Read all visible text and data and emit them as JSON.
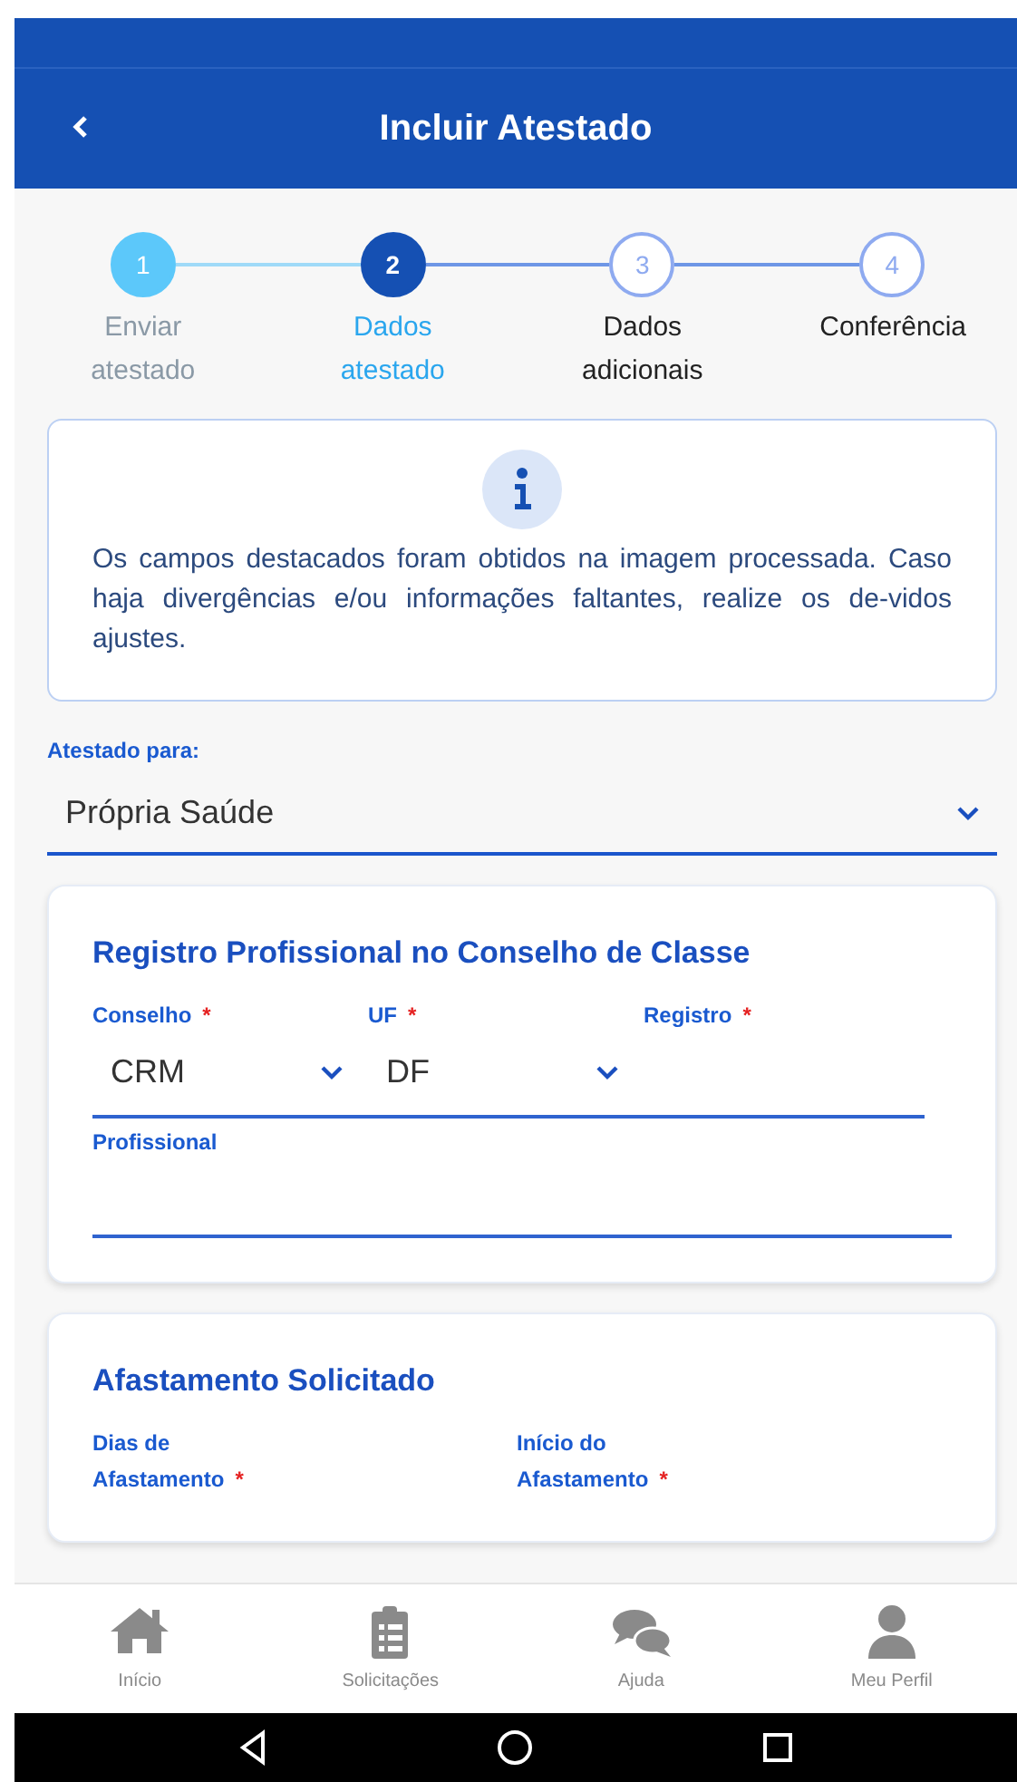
{
  "header": {
    "title": "Incluir Atestado"
  },
  "steps": [
    {
      "number": "1",
      "label": "Enviar atestado",
      "completed": true,
      "selected": false
    },
    {
      "number": "2",
      "label": "Dados atestado",
      "completed": false,
      "selected": true
    },
    {
      "number": "3",
      "label": "Dados adicionais",
      "completed": false,
      "selected": false
    },
    {
      "number": "4",
      "label": "Conferência",
      "completed": false,
      "selected": false
    }
  ],
  "info": {
    "text": "Os campos destacados foram obtidos na imagem processada. Caso haja divergências e/ou informações faltantes, realize os de-vidos ajustes."
  },
  "atestado_para": {
    "label": "Atestado para:",
    "value": "Própria Saúde"
  },
  "sections": [
    {
      "title": "Registro Profissional no Conselho de Classe",
      "fields": [
        {
          "kind": "select",
          "label": "Conselho",
          "required_mark": "*",
          "value": "CRM"
        },
        {
          "kind": "select",
          "label": "UF",
          "required_mark": "*",
          "value": "DF"
        },
        {
          "kind": "input",
          "label": "Registro",
          "required_mark": "*"
        },
        {
          "kind": "wide-input",
          "label": "Profissional"
        }
      ]
    },
    {
      "title": "Afastamento Solicitado",
      "fields": [
        {
          "kind": "cut",
          "label": "Dias de Afastamento",
          "required_mark": "*"
        },
        {
          "kind": "cut",
          "label": "Início do Afastamento",
          "required_mark": "*"
        }
      ]
    }
  ],
  "bottom_nav": [
    {
      "label": "Início"
    },
    {
      "label": "Solicitações"
    },
    {
      "label": "Ajuda"
    },
    {
      "label": "Meu Perfil"
    }
  ]
}
